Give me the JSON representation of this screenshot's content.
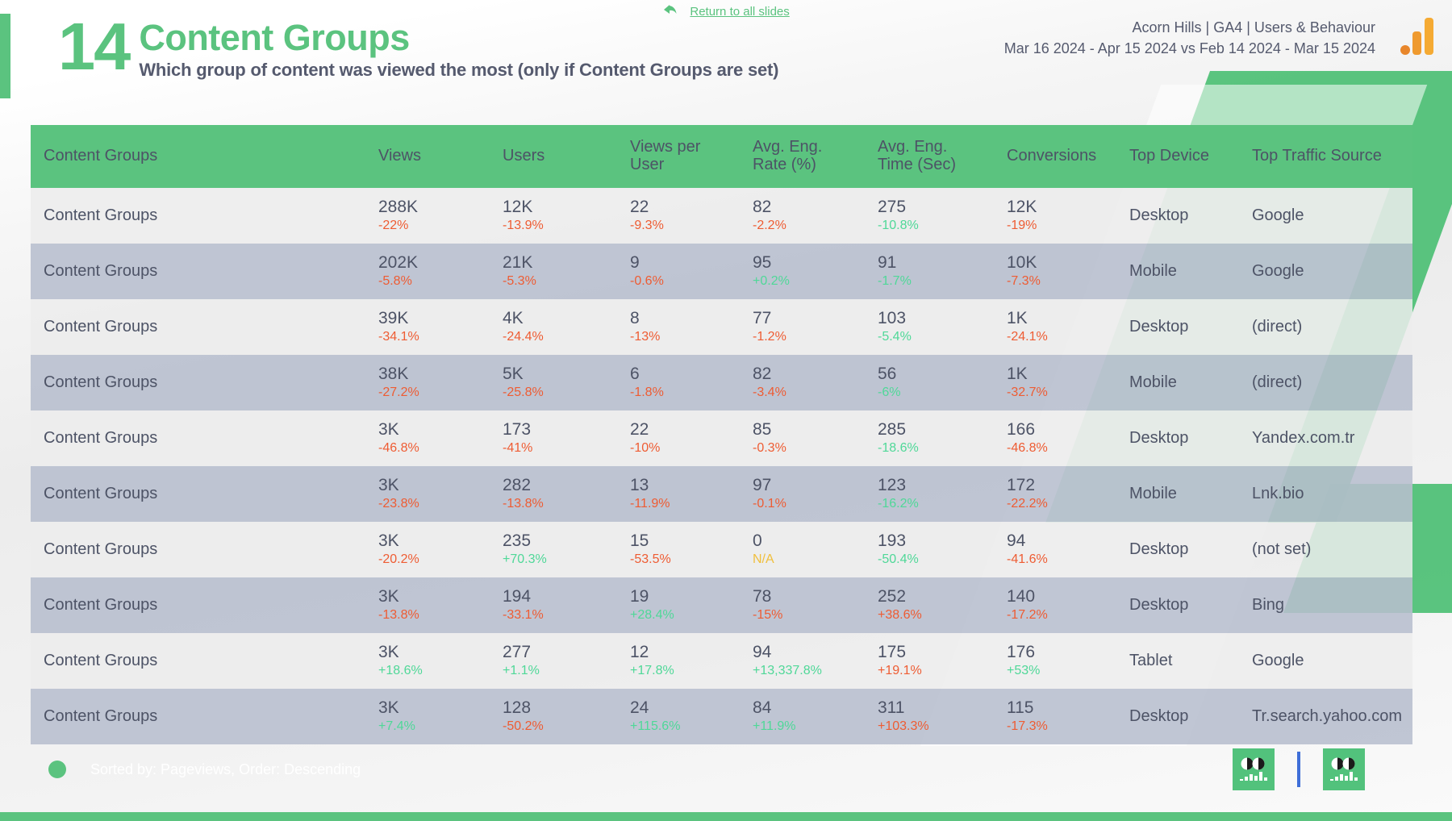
{
  "header": {
    "return_link": "Return to all slides",
    "return_arrow_icon": "back-arrow-icon",
    "slide_number": "14",
    "title": "Content Groups",
    "subtitle": "Which group of content was viewed the most (only if Content Groups are set)",
    "account_line": "Acorn Hills | GA4 | Users & Behaviour",
    "date_range_line": "Mar 16 2024 - Apr 15 2024 vs Feb 14 2024 - Mar 15 2024",
    "logo_icon": "google-analytics-logo"
  },
  "colors": {
    "brand_green": "#5bc37f",
    "header_text": "#4d5366",
    "delta_negative": "#ee5c33",
    "delta_positive": "#4fd898",
    "delta_na": "#f0bf3c",
    "row_odd": "#ececec",
    "row_even": "#b7becd",
    "divider_blue": "#3f6fd8",
    "logo_orange": "#f5aa33"
  },
  "table": {
    "columns": [
      "Content Groups",
      "Views",
      "Users",
      "Views per User",
      "Avg. Eng. Rate (%)",
      "Avg. Eng. Time (Sec)",
      "Conversions",
      "Top Device",
      "Top Traffic Source"
    ],
    "rows": [
      {
        "group": "Content Groups",
        "views": "288K",
        "views_delta": "-22%",
        "views_dir": "neg",
        "users": "12K",
        "users_delta": "-13.9%",
        "users_dir": "neg",
        "vpu": "22",
        "vpu_delta": "-9.3%",
        "vpu_dir": "neg",
        "eng_rate": "82",
        "eng_rate_delta": "-2.2%",
        "eng_rate_dir": "neg",
        "eng_time": "275",
        "eng_time_delta": "-10.8%",
        "eng_time_dir": "pos",
        "conversions": "12K",
        "conv_delta": "-19%",
        "conv_dir": "neg",
        "device": "Desktop",
        "source": "Google"
      },
      {
        "group": "Content Groups",
        "views": "202K",
        "views_delta": "-5.8%",
        "views_dir": "neg",
        "users": "21K",
        "users_delta": "-5.3%",
        "users_dir": "neg",
        "vpu": "9",
        "vpu_delta": "-0.6%",
        "vpu_dir": "neg",
        "eng_rate": "95",
        "eng_rate_delta": "+0.2%",
        "eng_rate_dir": "pos",
        "eng_time": "91",
        "eng_time_delta": "-1.7%",
        "eng_time_dir": "pos",
        "conversions": "10K",
        "conv_delta": "-7.3%",
        "conv_dir": "neg",
        "device": "Mobile",
        "source": "Google"
      },
      {
        "group": "Content Groups",
        "views": "39K",
        "views_delta": "-34.1%",
        "views_dir": "neg",
        "users": "4K",
        "users_delta": "-24.4%",
        "users_dir": "neg",
        "vpu": "8",
        "vpu_delta": "-13%",
        "vpu_dir": "neg",
        "eng_rate": "77",
        "eng_rate_delta": "-1.2%",
        "eng_rate_dir": "neg",
        "eng_time": "103",
        "eng_time_delta": "-5.4%",
        "eng_time_dir": "pos",
        "conversions": "1K",
        "conv_delta": "-24.1%",
        "conv_dir": "neg",
        "device": "Desktop",
        "source": "(direct)"
      },
      {
        "group": "Content Groups",
        "views": "38K",
        "views_delta": "-27.2%",
        "views_dir": "neg",
        "users": "5K",
        "users_delta": "-25.8%",
        "users_dir": "neg",
        "vpu": "6",
        "vpu_delta": "-1.8%",
        "vpu_dir": "neg",
        "eng_rate": "82",
        "eng_rate_delta": "-3.4%",
        "eng_rate_dir": "neg",
        "eng_time": "56",
        "eng_time_delta": "-6%",
        "eng_time_dir": "pos",
        "conversions": "1K",
        "conv_delta": "-32.7%",
        "conv_dir": "neg",
        "device": "Mobile",
        "source": "(direct)"
      },
      {
        "group": "Content Groups",
        "views": "3K",
        "views_delta": "-46.8%",
        "views_dir": "neg",
        "users": "173",
        "users_delta": "-41%",
        "users_dir": "neg",
        "vpu": "22",
        "vpu_delta": "-10%",
        "vpu_dir": "neg",
        "eng_rate": "85",
        "eng_rate_delta": "-0.3%",
        "eng_rate_dir": "neg",
        "eng_time": "285",
        "eng_time_delta": "-18.6%",
        "eng_time_dir": "pos",
        "conversions": "166",
        "conv_delta": "-46.8%",
        "conv_dir": "neg",
        "device": "Desktop",
        "source": "Yandex.com.tr"
      },
      {
        "group": "Content Groups",
        "views": "3K",
        "views_delta": "-23.8%",
        "views_dir": "neg",
        "users": "282",
        "users_delta": "-13.8%",
        "users_dir": "neg",
        "vpu": "13",
        "vpu_delta": "-11.9%",
        "vpu_dir": "neg",
        "eng_rate": "97",
        "eng_rate_delta": "-0.1%",
        "eng_rate_dir": "neg",
        "eng_time": "123",
        "eng_time_delta": "-16.2%",
        "eng_time_dir": "pos",
        "conversions": "172",
        "conv_delta": "-22.2%",
        "conv_dir": "neg",
        "device": "Mobile",
        "source": "Lnk.bio"
      },
      {
        "group": "Content Groups",
        "views": "3K",
        "views_delta": "-20.2%",
        "views_dir": "neg",
        "users": "235",
        "users_delta": "+70.3%",
        "users_dir": "pos",
        "vpu": "15",
        "vpu_delta": "-53.5%",
        "vpu_dir": "neg",
        "eng_rate": "0",
        "eng_rate_delta": "N/A",
        "eng_rate_dir": "na",
        "eng_time": "193",
        "eng_time_delta": "-50.4%",
        "eng_time_dir": "pos",
        "conversions": "94",
        "conv_delta": "-41.6%",
        "conv_dir": "neg",
        "device": "Desktop",
        "source": "(not set)"
      },
      {
        "group": "Content Groups",
        "views": "3K",
        "views_delta": "-13.8%",
        "views_dir": "neg",
        "users": "194",
        "users_delta": "-33.1%",
        "users_dir": "neg",
        "vpu": "19",
        "vpu_delta": "+28.4%",
        "vpu_dir": "pos",
        "eng_rate": "78",
        "eng_rate_delta": "-15%",
        "eng_rate_dir": "neg",
        "eng_time": "252",
        "eng_time_delta": "+38.6%",
        "eng_time_dir": "neg",
        "conversions": "140",
        "conv_delta": "-17.2%",
        "conv_dir": "neg",
        "device": "Desktop",
        "source": "Bing"
      },
      {
        "group": "Content Groups",
        "views": "3K",
        "views_delta": "+18.6%",
        "views_dir": "pos",
        "users": "277",
        "users_delta": "+1.1%",
        "users_dir": "pos",
        "vpu": "12",
        "vpu_delta": "+17.8%",
        "vpu_dir": "pos",
        "eng_rate": "94",
        "eng_rate_delta": "+13,337.8%",
        "eng_rate_dir": "pos",
        "eng_time": "175",
        "eng_time_delta": "+19.1%",
        "eng_time_dir": "neg",
        "conversions": "176",
        "conv_delta": "+53%",
        "conv_dir": "pos",
        "device": "Tablet",
        "source": "Google"
      },
      {
        "group": "Content Groups",
        "views": "3K",
        "views_delta": "+7.4%",
        "views_dir": "pos",
        "users": "128",
        "users_delta": "-50.2%",
        "users_dir": "neg",
        "vpu": "24",
        "vpu_delta": "+115.6%",
        "vpu_dir": "pos",
        "eng_rate": "84",
        "eng_rate_delta": "+11.9%",
        "eng_rate_dir": "pos",
        "eng_time": "311",
        "eng_time_delta": "+103.3%",
        "eng_time_dir": "neg",
        "conversions": "115",
        "conv_delta": "-17.3%",
        "conv_dir": "neg",
        "device": "Desktop",
        "source": "Tr.search.yahoo.com"
      }
    ]
  },
  "footer": {
    "sorted_note": "Sorted by: Pageviews, Order: Descending",
    "icon_left": "report-chart-icon",
    "icon_right": "report-chart-icon"
  }
}
